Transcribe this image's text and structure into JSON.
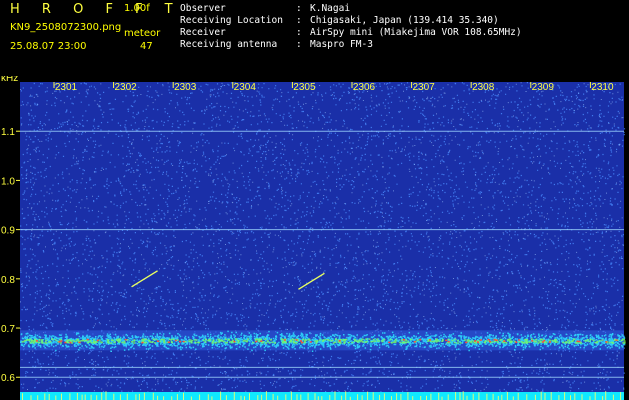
{
  "header": {
    "brand": "H R O F F T",
    "version": "1.00f",
    "filename": "KN9_2508072300.png",
    "mode": "meteor",
    "datetime": "25.08.07 23:00",
    "count": "47"
  },
  "meta": [
    {
      "label": "Observer",
      "value": "K.Nagai"
    },
    {
      "label": "Receiving Location",
      "value": "Chigasaki, Japan (139.414 35.340)"
    },
    {
      "label": "Receiver",
      "value": "AirSpy mini (Miakejima VOR 108.65MHz)"
    },
    {
      "label": "Receiving antenna",
      "value": "Maspro FM-3"
    }
  ],
  "meta_separator": ":",
  "spectrogram": {
    "y_unit": "kHz",
    "y_ticks": [
      "1.1",
      "1.0",
      "0.9",
      "0.8",
      "0.7",
      "0.6"
    ],
    "y_range": [
      0.57,
      1.2
    ],
    "x_ticks": [
      "2301",
      "2302",
      "2303",
      "2304",
      "2305",
      "2306",
      "2307",
      "2308",
      "2309",
      "2310"
    ],
    "horizontal_lines_khz": [
      1.1,
      0.9,
      0.62,
      0.6
    ],
    "noise_band_khz": 0.675,
    "colors": {
      "background": "#1a2fa8",
      "noise_dots": "#4a8cff",
      "band": "#2ee0ff",
      "band_hot": "#ff4a3a",
      "bottom_strip": "#10e8ff",
      "grid_line": "#9fd8ff",
      "tick_labels": "#ffff40"
    },
    "meteor_traces": [
      {
        "x_min": 2302.1,
        "y_khz": 0.8
      },
      {
        "x_min": 2304.9,
        "y_khz": 0.795
      }
    ]
  }
}
